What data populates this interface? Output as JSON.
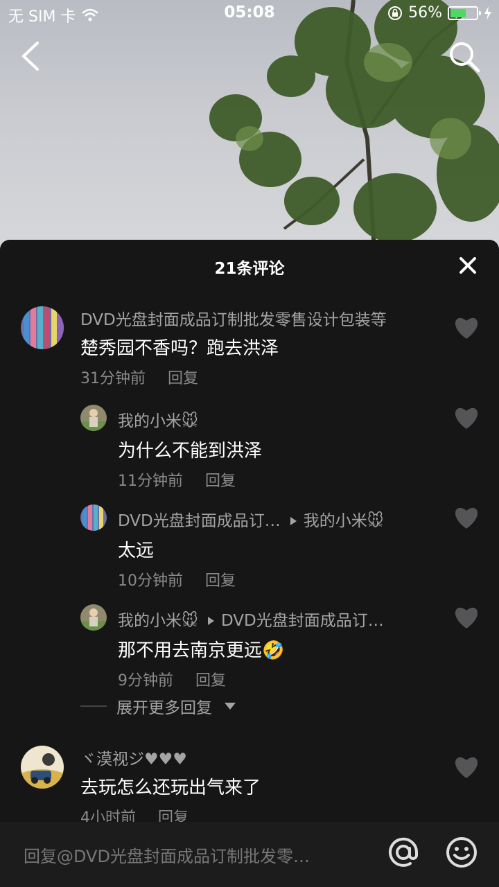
{
  "status_bar": {
    "carrier": "无 SIM 卡",
    "time": "05:08",
    "battery": "56%",
    "battery_level": 0.56,
    "icons": [
      "wifi-icon",
      "orientation-lock-icon",
      "battery-icon",
      "charging-icon"
    ]
  },
  "nav": {
    "back_icon": "chevron-left-icon",
    "search_icon": "search-icon"
  },
  "sheet": {
    "title": "21条评论",
    "close_icon": "close-icon"
  },
  "comments": [
    {
      "user": "DVD光盘封面成品订制批发零售设计包装等",
      "text": "楚秀园不香吗？跑去洪泽",
      "time": "31分钟前",
      "reply": "回复"
    },
    {
      "user": "我的小米🐭",
      "text": "为什么不能到洪泽",
      "time": "11分钟前",
      "reply": "回复"
    },
    {
      "user": "DVD光盘封面成品订…",
      "reply_to": "我的小米🐭",
      "text": "太远",
      "time": "10分钟前",
      "reply": "回复"
    },
    {
      "user": "我的小米🐭",
      "reply_to": "DVD光盘封面成品订…",
      "text": "那不用去南京更远🤣",
      "time": "9分钟前",
      "reply": "回复"
    },
    {
      "user": "ヾ漠视ジ♥♥♥",
      "text": "去玩怎么还玩出气来了",
      "time": "4小时前",
      "reply": "回复"
    }
  ],
  "expand_more": "展开更多回复",
  "input": {
    "placeholder": "回复@DVD光盘封面成品订制批发零…",
    "at_icon": "at-icon",
    "emoji_icon": "emoji-icon"
  },
  "colors": {
    "sheet_bg": "#161616",
    "battery": "#4cd964",
    "secondary_text": "#a4a4a6"
  }
}
